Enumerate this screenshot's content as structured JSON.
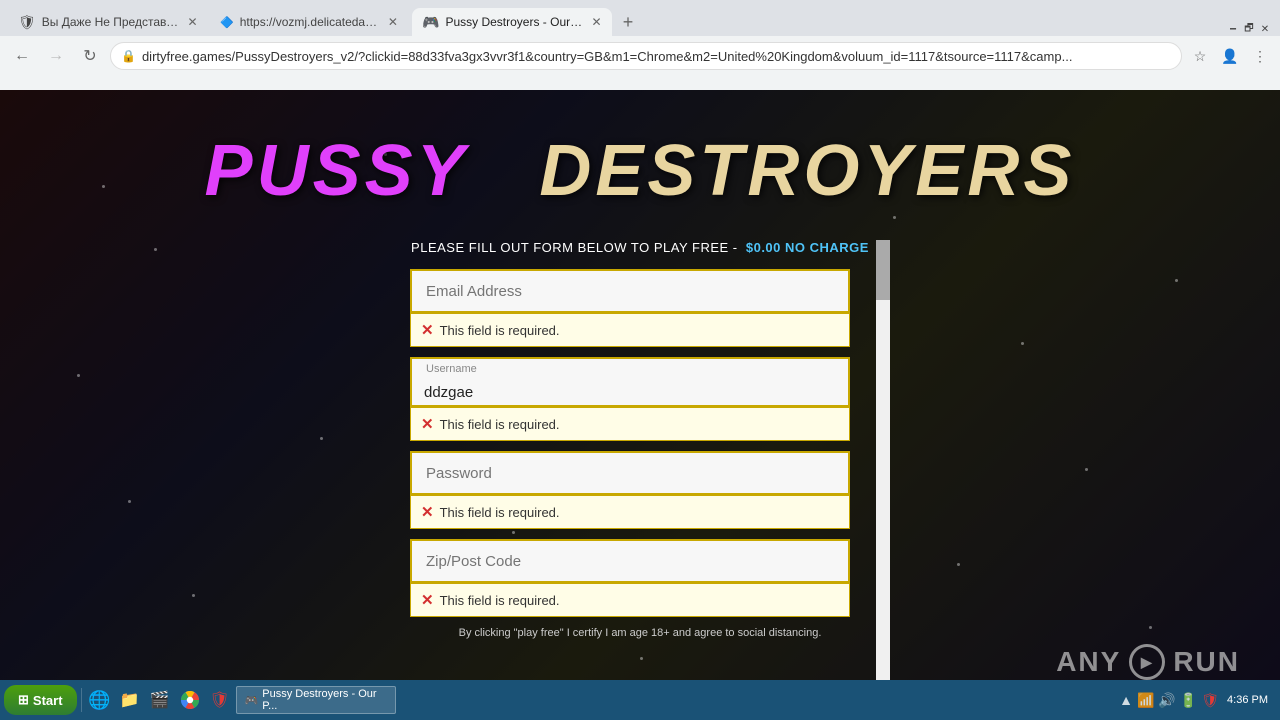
{
  "browser": {
    "tabs": [
      {
        "id": "tab1",
        "label": "Вы Даже Не Представляете Что Н...",
        "icon": "🛡",
        "active": false,
        "icon_color": "#c62828"
      },
      {
        "id": "tab2",
        "label": "https://vozmj.delicatedates.net/c/d...",
        "icon": "🔵",
        "active": false
      },
      {
        "id": "tab3",
        "label": "Pussy Destroyers - Our Porn Games...",
        "icon": "🎮",
        "active": true
      }
    ],
    "new_tab_label": "+",
    "address": "dirtyfree.games/PussyDestroyers_v2/?clickid=88d33fva3gx3vvr3f1&country=GB&m1=Chrome&m2=United%20Kingdom&voluum_id=1117&tsource=1117&camp...",
    "back_disabled": false,
    "forward_disabled": true
  },
  "page": {
    "title_word1": "PUSSY",
    "title_word2": "DESTROYERS",
    "subtitle": "PLEASE FILL OUT FORM BELOW TO PLAY FREE -",
    "price_label": "$0.00 NO CHARGE",
    "fields": {
      "email": {
        "placeholder": "Email Address",
        "value": ""
      },
      "username": {
        "label": "Username",
        "value": "ddzgae"
      },
      "password": {
        "placeholder": "Password",
        "value": ""
      },
      "zip": {
        "placeholder": "Zip/Post Code",
        "value": ""
      }
    },
    "errors": {
      "message": "This field is required."
    },
    "footer_text": "By clicking \"play free\" I certify I am age 18+ and agree to social distancing.",
    "watermark": "ANY RUN"
  },
  "taskbar": {
    "start_label": "Start",
    "time": "4:36 PM",
    "tasks": [
      {
        "label": "IE",
        "icon": "🌐"
      },
      {
        "label": "Files",
        "icon": "📁"
      },
      {
        "label": "Media",
        "icon": "🎬"
      },
      {
        "label": "Chrome",
        "icon": "🌐"
      },
      {
        "label": "Shield",
        "icon": "🛡"
      }
    ]
  }
}
